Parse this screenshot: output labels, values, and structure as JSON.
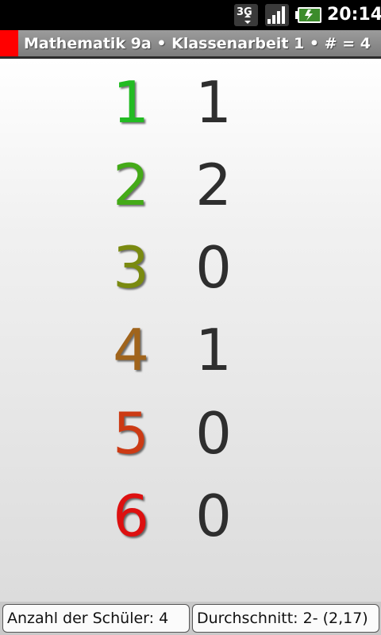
{
  "status_bar": {
    "network_label": "3G",
    "time": "20:14",
    "icons": [
      "3g-icon",
      "signal-icon",
      "battery-icon"
    ]
  },
  "title_bar": {
    "tag_color": "#ff0000",
    "title": "Mathematik 9a • Klassenarbeit 1 • # = 4"
  },
  "grades": [
    {
      "grade": "1",
      "count": "1",
      "color": "#22bb22"
    },
    {
      "grade": "2",
      "count": "2",
      "color": "#44aa18"
    },
    {
      "grade": "3",
      "count": "0",
      "color": "#7a8a10"
    },
    {
      "grade": "4",
      "count": "1",
      "color": "#a0641c"
    },
    {
      "grade": "5",
      "count": "0",
      "color": "#cc3a14"
    },
    {
      "grade": "6",
      "count": "0",
      "color": "#dd1010"
    }
  ],
  "footer": {
    "students_label": "Anzahl der Schüler: 4",
    "average_label": "Durchschnitt: 2- (2,17)"
  }
}
